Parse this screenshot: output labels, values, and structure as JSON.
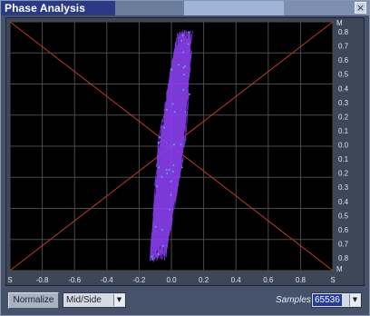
{
  "window": {
    "title": "Phase Analysis",
    "close_glyph": "×"
  },
  "scope": {
    "top_marker_right": "M",
    "bottom_marker_right": "M",
    "right_axis_labels": [
      "0.8",
      "0.7",
      "0.6",
      "0.5",
      "0.4",
      "0.3",
      "0.2",
      "0.1",
      "0.0",
      "0.1",
      "0.2",
      "0.3",
      "0.4",
      "0.5",
      "0.6",
      "0.7",
      "0.8"
    ],
    "bottom_axis_labels": [
      "S",
      "-0.8",
      "-0.6",
      "-0.4",
      "-0.2",
      "0.0",
      "0.2",
      "0.4",
      "0.6",
      "0.8",
      "S"
    ],
    "colors": {
      "background": "#000000",
      "grid": "#4a4a4a",
      "diagonal": "#c0392b",
      "trace": "#8a3ff0",
      "trace_highlight": "#4fc3f7"
    }
  },
  "controls": {
    "normalize_button": "Normalize",
    "mode_select": "Mid/Side",
    "samples_label": "Samples",
    "samples_select": "65536"
  }
}
